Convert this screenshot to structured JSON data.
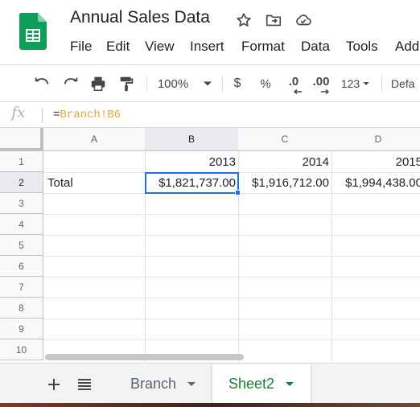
{
  "app": {
    "title": "Annual Sales Data",
    "brand_color": "#0f9d58"
  },
  "menu": [
    "File",
    "Edit",
    "View",
    "Insert",
    "Format",
    "Data",
    "Tools",
    "Add"
  ],
  "toolbar": {
    "zoom": "100%",
    "currency": "$",
    "percent": "%",
    "decrease_decimals": ".0",
    "increase_decimals": ".00",
    "more_formats": "123",
    "font": "Defa"
  },
  "formula_bar": {
    "fx": "fx",
    "equals": "=",
    "reference": "Branch!B6"
  },
  "grid": {
    "columns": [
      "A",
      "B",
      "C",
      "D"
    ],
    "rows": [
      "1",
      "2",
      "3",
      "4",
      "5",
      "6",
      "7",
      "8",
      "9",
      "10"
    ],
    "cells": {
      "B1": "2013",
      "C1": "2014",
      "D1": "2015",
      "A2": "Total",
      "B2": "$1,821,737.00",
      "C2": "$1,916,712.00",
      "D2": "$1,994,438.00"
    },
    "selected_cell": "B2"
  },
  "sheets": {
    "tabs": [
      {
        "label": "Branch",
        "active": false
      },
      {
        "label": "Sheet2",
        "active": true
      }
    ],
    "active_color": "#188038"
  }
}
